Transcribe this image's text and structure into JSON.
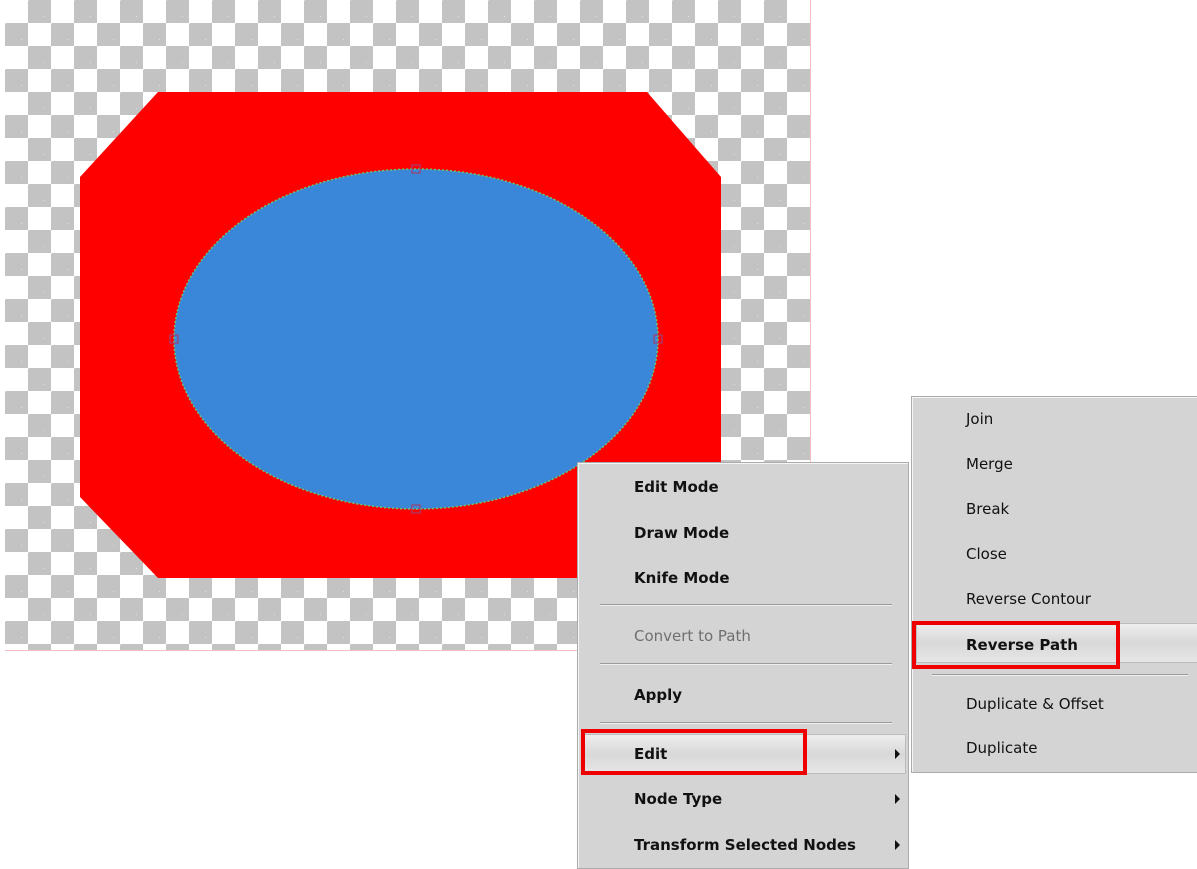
{
  "context_menu": {
    "items": [
      {
        "label": "Edit Mode",
        "bold": true
      },
      {
        "label": "Draw Mode",
        "bold": true
      },
      {
        "label": "Knife Mode",
        "bold": true
      },
      {
        "label": "Convert to Path",
        "disabled": true
      },
      {
        "label": "Apply",
        "bold": true
      },
      {
        "label": "Edit",
        "bold": true,
        "submenu": true,
        "highlighted": true
      },
      {
        "label": "Node Type",
        "bold": true,
        "submenu": true
      },
      {
        "label": "Transform Selected Nodes",
        "bold": true,
        "submenu": true
      }
    ]
  },
  "edit_submenu": {
    "items": [
      {
        "label": "Join",
        "disabled": true
      },
      {
        "label": "Merge",
        "disabled": true
      },
      {
        "label": "Break",
        "disabled": true
      },
      {
        "label": "Close",
        "disabled": true
      },
      {
        "label": "Reverse Contour",
        "disabled": true
      },
      {
        "label": "Reverse Path",
        "bold": true,
        "highlighted": true
      },
      {
        "label": "Duplicate & Offset",
        "disabled": true
      },
      {
        "label": "Duplicate",
        "disabled": true
      }
    ]
  },
  "colors": {
    "octagon_fill": "#ff0000",
    "ellipse_fill": "#3a86d8",
    "callout_border": "#ee0000",
    "checker_dark": "#c3c3c3"
  }
}
